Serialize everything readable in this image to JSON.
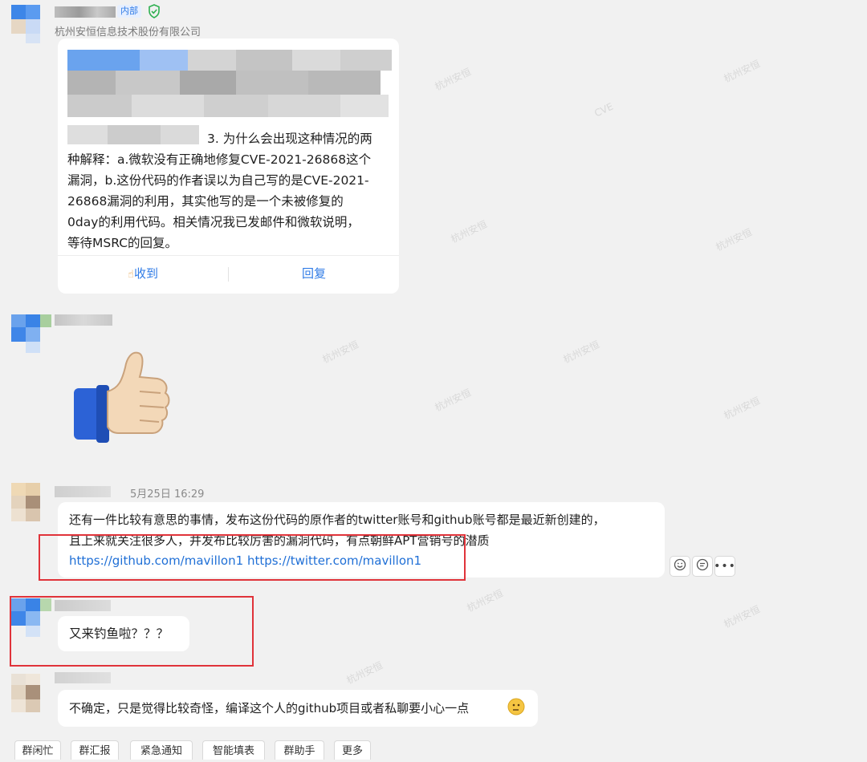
{
  "msg1": {
    "badge": "内部",
    "company": "杭州安恒信息技术股份有限公司",
    "visible_line1": "3. 为什么会出现这种情况的两",
    "lines": [
      "种解释：a.微软没有正确地修复CVE-2021-26868这个",
      "漏洞，b.这份代码的作者误以为自己写的是CVE-2021-",
      "26868漏洞的利用，其实他写的是一个未被修复的",
      "0day的利用代码。相关情况我已发邮件和微软说明，",
      "等待MSRC的回复。"
    ],
    "ack_label": "收到",
    "reply_label": "回复"
  },
  "msg3": {
    "time": "5月25日 16:29",
    "line1": "还有一件比较有意思的事情，发布这份代码的原作者的twitter账号和github账号都是最近新创建的，",
    "line2": "且上来就关注很多人，并发布比较厉害的漏洞代码，有点朝鲜APT营销号的潜质",
    "link1": "https://github.com/mavillon1",
    "link2": "https://twitter.com/mavillon1"
  },
  "msg4": {
    "text": "又来钓鱼啦？？？"
  },
  "msg5": {
    "text": "不确定，只是觉得比较奇怪，编译这个人的github项目或者私聊要小心一点"
  },
  "toolbar": {
    "items": [
      "群闲忙",
      "群汇报",
      "紧急通知",
      "智能填表",
      "群助手",
      "更多"
    ]
  },
  "colors": {
    "link": "#1f6fd6",
    "highlight_box": "#e0333a",
    "background": "#f1f1f1"
  }
}
